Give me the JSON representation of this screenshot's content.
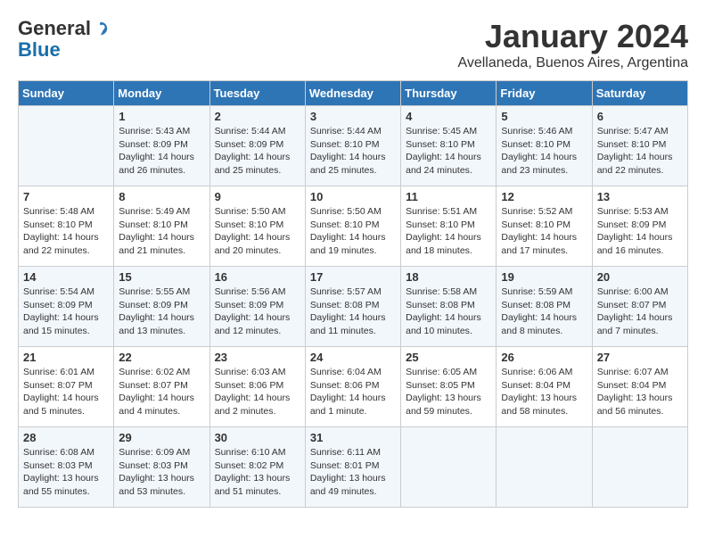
{
  "header": {
    "logo_general": "General",
    "logo_blue": "Blue",
    "title": "January 2024",
    "subtitle": "Avellaneda, Buenos Aires, Argentina"
  },
  "days_of_week": [
    "Sunday",
    "Monday",
    "Tuesday",
    "Wednesday",
    "Thursday",
    "Friday",
    "Saturday"
  ],
  "weeks": [
    [
      {
        "day": null,
        "info": null
      },
      {
        "day": "1",
        "info": "Sunrise: 5:43 AM\nSunset: 8:09 PM\nDaylight: 14 hours\nand 26 minutes."
      },
      {
        "day": "2",
        "info": "Sunrise: 5:44 AM\nSunset: 8:09 PM\nDaylight: 14 hours\nand 25 minutes."
      },
      {
        "day": "3",
        "info": "Sunrise: 5:44 AM\nSunset: 8:10 PM\nDaylight: 14 hours\nand 25 minutes."
      },
      {
        "day": "4",
        "info": "Sunrise: 5:45 AM\nSunset: 8:10 PM\nDaylight: 14 hours\nand 24 minutes."
      },
      {
        "day": "5",
        "info": "Sunrise: 5:46 AM\nSunset: 8:10 PM\nDaylight: 14 hours\nand 23 minutes."
      },
      {
        "day": "6",
        "info": "Sunrise: 5:47 AM\nSunset: 8:10 PM\nDaylight: 14 hours\nand 22 minutes."
      }
    ],
    [
      {
        "day": "7",
        "info": "Sunrise: 5:48 AM\nSunset: 8:10 PM\nDaylight: 14 hours\nand 22 minutes."
      },
      {
        "day": "8",
        "info": "Sunrise: 5:49 AM\nSunset: 8:10 PM\nDaylight: 14 hours\nand 21 minutes."
      },
      {
        "day": "9",
        "info": "Sunrise: 5:50 AM\nSunset: 8:10 PM\nDaylight: 14 hours\nand 20 minutes."
      },
      {
        "day": "10",
        "info": "Sunrise: 5:50 AM\nSunset: 8:10 PM\nDaylight: 14 hours\nand 19 minutes."
      },
      {
        "day": "11",
        "info": "Sunrise: 5:51 AM\nSunset: 8:10 PM\nDaylight: 14 hours\nand 18 minutes."
      },
      {
        "day": "12",
        "info": "Sunrise: 5:52 AM\nSunset: 8:10 PM\nDaylight: 14 hours\nand 17 minutes."
      },
      {
        "day": "13",
        "info": "Sunrise: 5:53 AM\nSunset: 8:09 PM\nDaylight: 14 hours\nand 16 minutes."
      }
    ],
    [
      {
        "day": "14",
        "info": "Sunrise: 5:54 AM\nSunset: 8:09 PM\nDaylight: 14 hours\nand 15 minutes."
      },
      {
        "day": "15",
        "info": "Sunrise: 5:55 AM\nSunset: 8:09 PM\nDaylight: 14 hours\nand 13 minutes."
      },
      {
        "day": "16",
        "info": "Sunrise: 5:56 AM\nSunset: 8:09 PM\nDaylight: 14 hours\nand 12 minutes."
      },
      {
        "day": "17",
        "info": "Sunrise: 5:57 AM\nSunset: 8:08 PM\nDaylight: 14 hours\nand 11 minutes."
      },
      {
        "day": "18",
        "info": "Sunrise: 5:58 AM\nSunset: 8:08 PM\nDaylight: 14 hours\nand 10 minutes."
      },
      {
        "day": "19",
        "info": "Sunrise: 5:59 AM\nSunset: 8:08 PM\nDaylight: 14 hours\nand 8 minutes."
      },
      {
        "day": "20",
        "info": "Sunrise: 6:00 AM\nSunset: 8:07 PM\nDaylight: 14 hours\nand 7 minutes."
      }
    ],
    [
      {
        "day": "21",
        "info": "Sunrise: 6:01 AM\nSunset: 8:07 PM\nDaylight: 14 hours\nand 5 minutes."
      },
      {
        "day": "22",
        "info": "Sunrise: 6:02 AM\nSunset: 8:07 PM\nDaylight: 14 hours\nand 4 minutes."
      },
      {
        "day": "23",
        "info": "Sunrise: 6:03 AM\nSunset: 8:06 PM\nDaylight: 14 hours\nand 2 minutes."
      },
      {
        "day": "24",
        "info": "Sunrise: 6:04 AM\nSunset: 8:06 PM\nDaylight: 14 hours\nand 1 minute."
      },
      {
        "day": "25",
        "info": "Sunrise: 6:05 AM\nSunset: 8:05 PM\nDaylight: 13 hours\nand 59 minutes."
      },
      {
        "day": "26",
        "info": "Sunrise: 6:06 AM\nSunset: 8:04 PM\nDaylight: 13 hours\nand 58 minutes."
      },
      {
        "day": "27",
        "info": "Sunrise: 6:07 AM\nSunset: 8:04 PM\nDaylight: 13 hours\nand 56 minutes."
      }
    ],
    [
      {
        "day": "28",
        "info": "Sunrise: 6:08 AM\nSunset: 8:03 PM\nDaylight: 13 hours\nand 55 minutes."
      },
      {
        "day": "29",
        "info": "Sunrise: 6:09 AM\nSunset: 8:03 PM\nDaylight: 13 hours\nand 53 minutes."
      },
      {
        "day": "30",
        "info": "Sunrise: 6:10 AM\nSunset: 8:02 PM\nDaylight: 13 hours\nand 51 minutes."
      },
      {
        "day": "31",
        "info": "Sunrise: 6:11 AM\nSunset: 8:01 PM\nDaylight: 13 hours\nand 49 minutes."
      },
      {
        "day": null,
        "info": null
      },
      {
        "day": null,
        "info": null
      },
      {
        "day": null,
        "info": null
      }
    ]
  ]
}
